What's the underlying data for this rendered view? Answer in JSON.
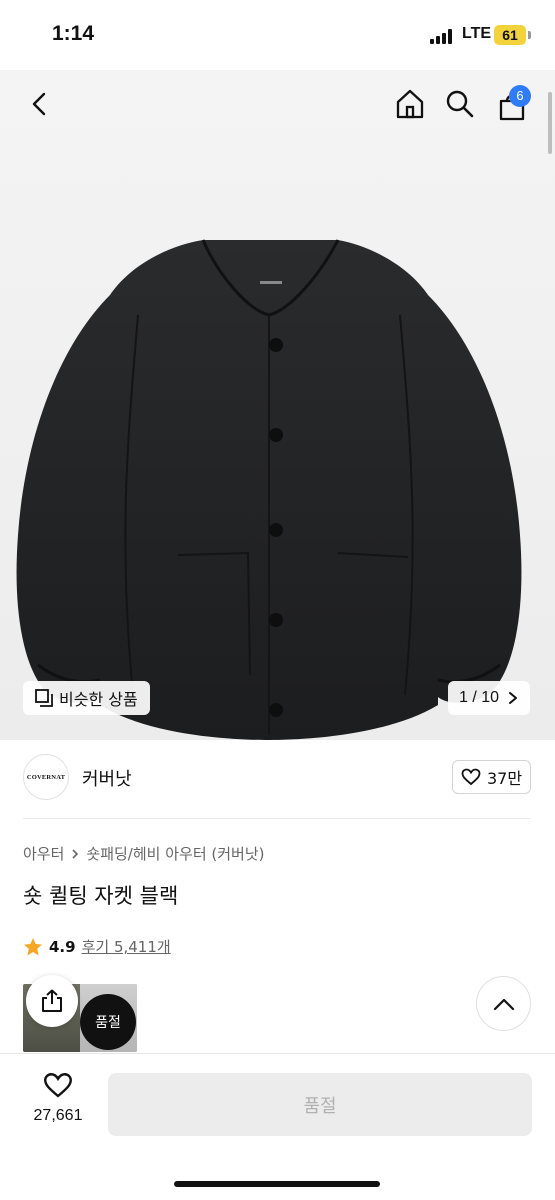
{
  "status_bar": {
    "time": "1:14",
    "network": "LTE",
    "battery": "61"
  },
  "nav": {
    "cart_count": "6"
  },
  "gallery": {
    "similar_label": "비슷한 상품",
    "page_indicator": "1 / 10"
  },
  "brand": {
    "logo_text": "COVERNAT",
    "name": "커버낫",
    "likes": "37만"
  },
  "product": {
    "breadcrumb": [
      "아우터",
      "숏패딩/헤비 아우터 (커버낫)"
    ],
    "title": "숏 퀼팅 자켓 블랙",
    "rating": "4.9",
    "reviews": "후기 5,411개",
    "soldout_thumb_label": "품절"
  },
  "bottom_bar": {
    "wish_count": "27,661",
    "buy_label": "품절"
  },
  "colors": {
    "accent_badge": "#2f7cf6",
    "star": "#f5a623",
    "battery": "#f3d33c"
  }
}
